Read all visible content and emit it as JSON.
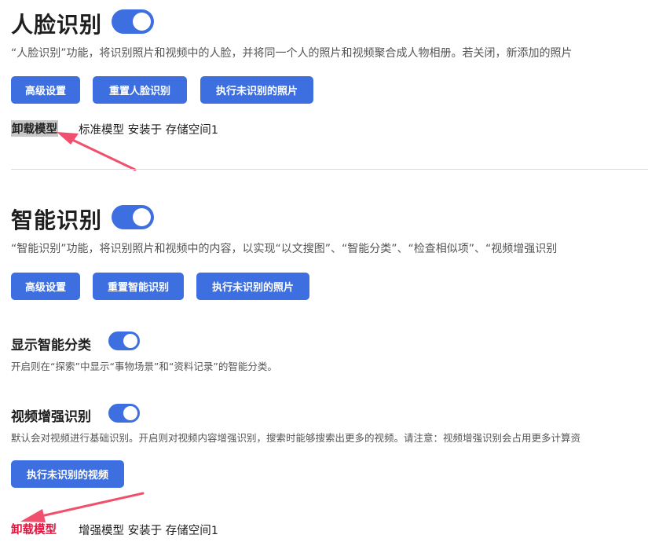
{
  "face": {
    "title": "人脸识别",
    "enabled": true,
    "description": "“人脸识别”功能，将识别照片和视频中的人脸，并将同一个人的照片和视频聚合成人物相册。若关闭，新添加的照片",
    "buttons": [
      "高级设置",
      "重置人脸识别",
      "执行未识别的照片"
    ],
    "uninstall_label": "卸载模型",
    "model_info": "标准模型 安装于 存储空间1"
  },
  "smart": {
    "title": "智能识别",
    "enabled": true,
    "description": "“智能识别”功能，将识别照片和视频中的内容，以实现“以文搜图”、“智能分类”、“检查相似项”、“视频增强识别",
    "buttons": [
      "高级设置",
      "重置智能识别",
      "执行未识别的照片"
    ],
    "show_category": {
      "title": "显示智能分类",
      "enabled": true,
      "description": "开启则在“探索”中显示“事物场景”和“资料记录”的智能分类。"
    },
    "video_enhance": {
      "title": "视频增强识别",
      "enabled": true,
      "description": "默认会对视频进行基础识别。开启则对视频内容增强识别，搜索时能够搜索出更多的视频。请注意：视频增强识别会占用更多计算资",
      "button": "执行未识别的视频"
    },
    "uninstall_label": "卸载模型",
    "model_info": "增强模型 安装于 存储空间1"
  },
  "colors": {
    "accent": "#3d6fe0",
    "uninstall_highlight_bg": "#c7c7c7",
    "uninstall_red": "#e0143c",
    "arrow": "#f0506e"
  }
}
